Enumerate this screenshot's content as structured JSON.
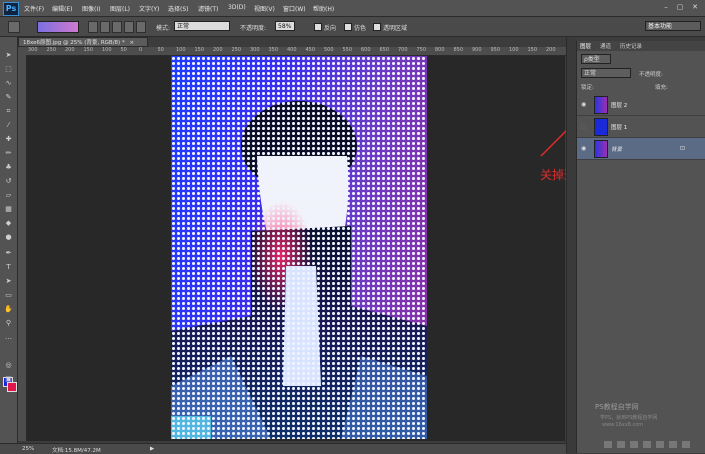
{
  "app": {
    "logo": "Ps"
  },
  "menu": {
    "items": [
      "文件(F)",
      "编辑(E)",
      "图像(I)",
      "图层(L)",
      "文字(Y)",
      "选择(S)",
      "滤镜(T)",
      "3D(D)",
      "视图(V)",
      "窗口(W)",
      "帮助(H)"
    ],
    "window_controls": [
      "–",
      "▢",
      "✕"
    ]
  },
  "options_bar": {
    "mode_label": "模式:",
    "mode_value": "正常",
    "opacity_label": "不透明度:",
    "opacity_value": "58%",
    "reverse_label": "反向",
    "dither_label": "仿色",
    "transparency_label": "透明区域"
  },
  "workspace": {
    "value": "基本功能"
  },
  "document_tab": {
    "title": "18xe6原图.jpg @ 25% (背景, RGB/8) *",
    "close": "×"
  },
  "ruler": {
    "top_ticks": [
      "300",
      "250",
      "200",
      "150",
      "100",
      "50",
      "0",
      "50",
      "100",
      "150",
      "200",
      "250",
      "300",
      "350",
      "400",
      "450",
      "500",
      "550",
      "600",
      "650",
      "700",
      "750",
      "800",
      "850",
      "900",
      "950",
      "100",
      "150",
      "200"
    ]
  },
  "annotation": {
    "text": "关掉这个图层"
  },
  "status": {
    "zoom": "25%",
    "doc_info": "文档:15.8M/47.2M"
  },
  "panels": {
    "tabs": [
      "图层",
      "通道",
      "历史记录"
    ],
    "kind_label": "ρ类型",
    "blend_mode": "正常",
    "opacity_label": "不透明度:",
    "lock_label": "锁定:",
    "fill_label": "填充:",
    "layers": [
      {
        "name": "图层 2",
        "visible": true
      },
      {
        "name": "图层 1",
        "visible": false
      },
      {
        "name": "背景",
        "visible": true,
        "selected": true
      }
    ]
  },
  "watermark": {
    "line1": "PS教程自学网",
    "line2": "学PS，就到PS教程自学网",
    "line3": "www.16xx8.com"
  },
  "colors": {
    "foreground": "#1a2ad8",
    "background": "#e0164c",
    "annotation": "#e02a2a"
  }
}
